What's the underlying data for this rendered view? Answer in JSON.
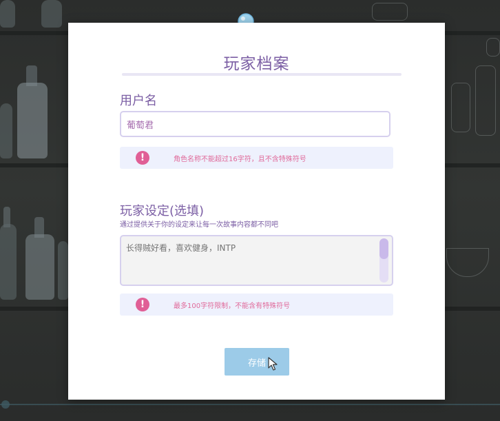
{
  "dialog": {
    "title": "玩家档案",
    "username": {
      "label": "用户名",
      "value": "葡萄君",
      "hint_icon": "exclamation-icon",
      "hint": "角色名称不能超过16字符，且不含特殊符号"
    },
    "settings": {
      "label": "玩家设定(选填)",
      "sublabel": "通过提供关于你的设定来让每一次故事内容都不同吧",
      "placeholder": "长得贼好看，喜欢健身，INTP",
      "hint_icon": "exclamation-icon",
      "hint": "最多100字符限制，不能含有特殊符号"
    },
    "save_label": "存储"
  },
  "colors": {
    "accent": "#7b5ea4",
    "hint_pink": "#e05f96",
    "button_blue": "#9ccbe8",
    "hint_bg": "#eef1fd"
  }
}
